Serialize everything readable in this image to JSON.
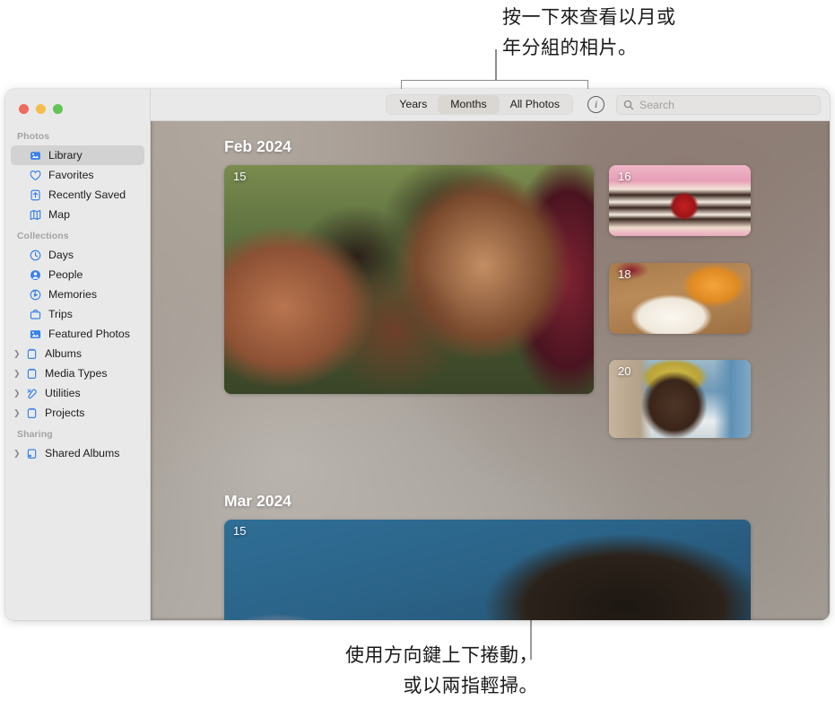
{
  "callouts": {
    "top": "按一下來查看以月或\n年分組的相片。",
    "bottom": "使用方向鍵上下捲動，\n或以兩指輕掃。"
  },
  "window": {
    "traffic_lights": [
      {
        "name": "close",
        "color": "#ec6a5e"
      },
      {
        "name": "minimize",
        "color": "#f4bd4f"
      },
      {
        "name": "maximize",
        "color": "#61c454"
      }
    ]
  },
  "sidebar": {
    "groups": [
      {
        "label": "Photos",
        "items": [
          {
            "label": "Library",
            "icon": "library-icon",
            "selected": true,
            "disclosure": false
          },
          {
            "label": "Favorites",
            "icon": "heart-icon",
            "selected": false,
            "disclosure": false
          },
          {
            "label": "Recently Saved",
            "icon": "save-icon",
            "selected": false,
            "disclosure": false
          },
          {
            "label": "Map",
            "icon": "map-icon",
            "selected": false,
            "disclosure": false
          }
        ]
      },
      {
        "label": "Collections",
        "items": [
          {
            "label": "Days",
            "icon": "clock-icon",
            "selected": false,
            "disclosure": false
          },
          {
            "label": "People",
            "icon": "person-icon",
            "selected": false,
            "disclosure": false
          },
          {
            "label": "Memories",
            "icon": "memories-icon",
            "selected": false,
            "disclosure": false
          },
          {
            "label": "Trips",
            "icon": "suitcase-icon",
            "selected": false,
            "disclosure": false
          },
          {
            "label": "Featured Photos",
            "icon": "featured-photos-icon",
            "selected": false,
            "disclosure": false
          },
          {
            "label": "Albums",
            "icon": "album-icon",
            "selected": false,
            "disclosure": true
          },
          {
            "label": "Media Types",
            "icon": "album-icon",
            "selected": false,
            "disclosure": true
          },
          {
            "label": "Utilities",
            "icon": "utilities-icon",
            "selected": false,
            "disclosure": true
          },
          {
            "label": "Projects",
            "icon": "album-icon",
            "selected": false,
            "disclosure": true
          }
        ]
      },
      {
        "label": "Sharing",
        "items": [
          {
            "label": "Shared Albums",
            "icon": "shared-album-icon",
            "selected": false,
            "disclosure": true
          }
        ]
      }
    ]
  },
  "toolbar": {
    "segments": [
      {
        "label": "Years",
        "active": false
      },
      {
        "label": "Months",
        "active": true
      },
      {
        "label": "All Photos",
        "active": false
      }
    ],
    "info_label": "i",
    "search_placeholder": "Search"
  },
  "photos": {
    "sections": [
      {
        "title": "Feb 2024",
        "tiles": [
          {
            "day": "15",
            "style": "ph-group"
          },
          {
            "day": "16",
            "style": "ph-cake"
          },
          {
            "day": "18",
            "style": "ph-food"
          },
          {
            "day": "20",
            "style": "ph-portrait"
          }
        ]
      },
      {
        "title": "Mar 2024",
        "tiles": [
          {
            "day": "15",
            "style": "ph-blue"
          }
        ]
      }
    ]
  }
}
